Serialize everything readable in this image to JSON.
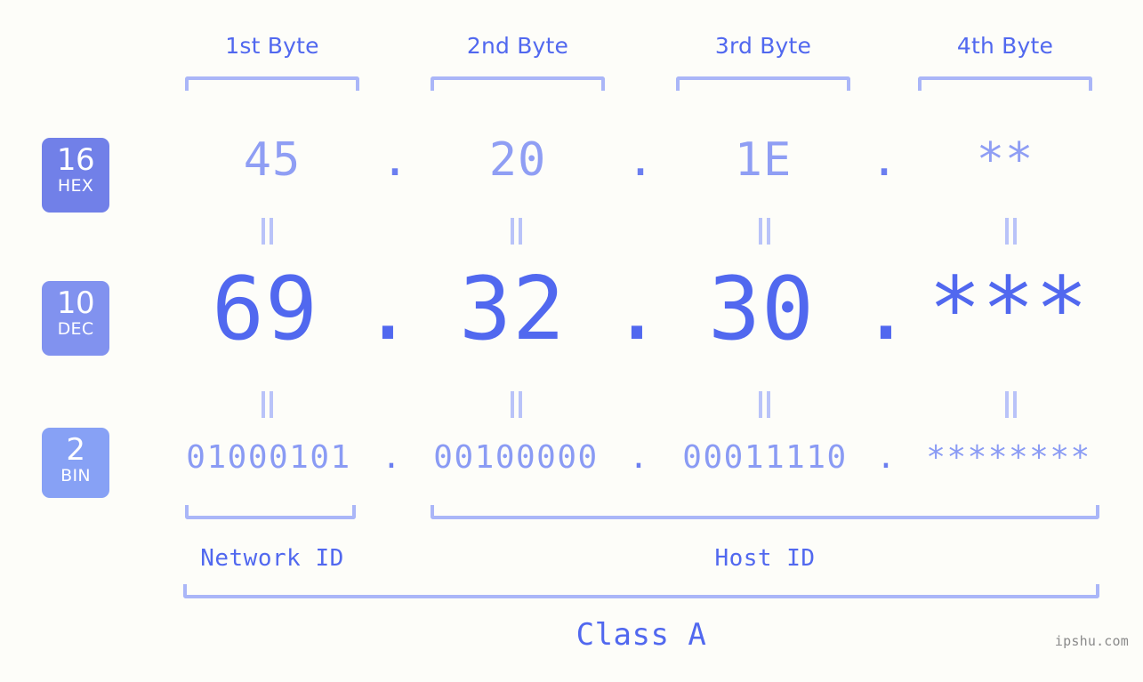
{
  "background_color": "#fdfdf9",
  "accent_colors": {
    "dec_blue": "#5168ef",
    "hex_blue": "#8f9ef4",
    "bin_blue": "#8a9bf4",
    "bracket_blue": "#aab6f8",
    "badge_hex": "#7180e8",
    "badge_dec": "#8192ef",
    "badge_bin": "#87a1f5",
    "watermark_gray": "#8b8b8b"
  },
  "byte_headers": [
    {
      "label": "1st Byte"
    },
    {
      "label": "2nd Byte"
    },
    {
      "label": "3rd Byte"
    },
    {
      "label": "4th Byte"
    }
  ],
  "bases": [
    {
      "number": "16",
      "name": "HEX"
    },
    {
      "number": "10",
      "name": "DEC"
    },
    {
      "number": "2",
      "name": "BIN"
    }
  ],
  "rows": {
    "hex": {
      "base_number": "16",
      "base_name": "HEX",
      "values": [
        "45",
        "20",
        "1E",
        "**"
      ],
      "separators": [
        ".",
        ".",
        "."
      ]
    },
    "dec": {
      "base_number": "10",
      "base_name": "DEC",
      "values": [
        "69",
        "32",
        "30",
        "***"
      ],
      "separators": [
        ".",
        ".",
        "."
      ]
    },
    "bin": {
      "base_number": "2",
      "base_name": "BIN",
      "values": [
        "01000101",
        "00100000",
        "00011110",
        "********"
      ],
      "separators": [
        ".",
        ".",
        "."
      ]
    }
  },
  "equality_marks": {
    "symbol": "=",
    "count_per_row": 4,
    "rows": 2
  },
  "id_sections": [
    {
      "label": "Network ID"
    },
    {
      "label": "Host ID"
    }
  ],
  "class": {
    "label": "Class A"
  },
  "watermark": {
    "text": "ipshu.com"
  }
}
